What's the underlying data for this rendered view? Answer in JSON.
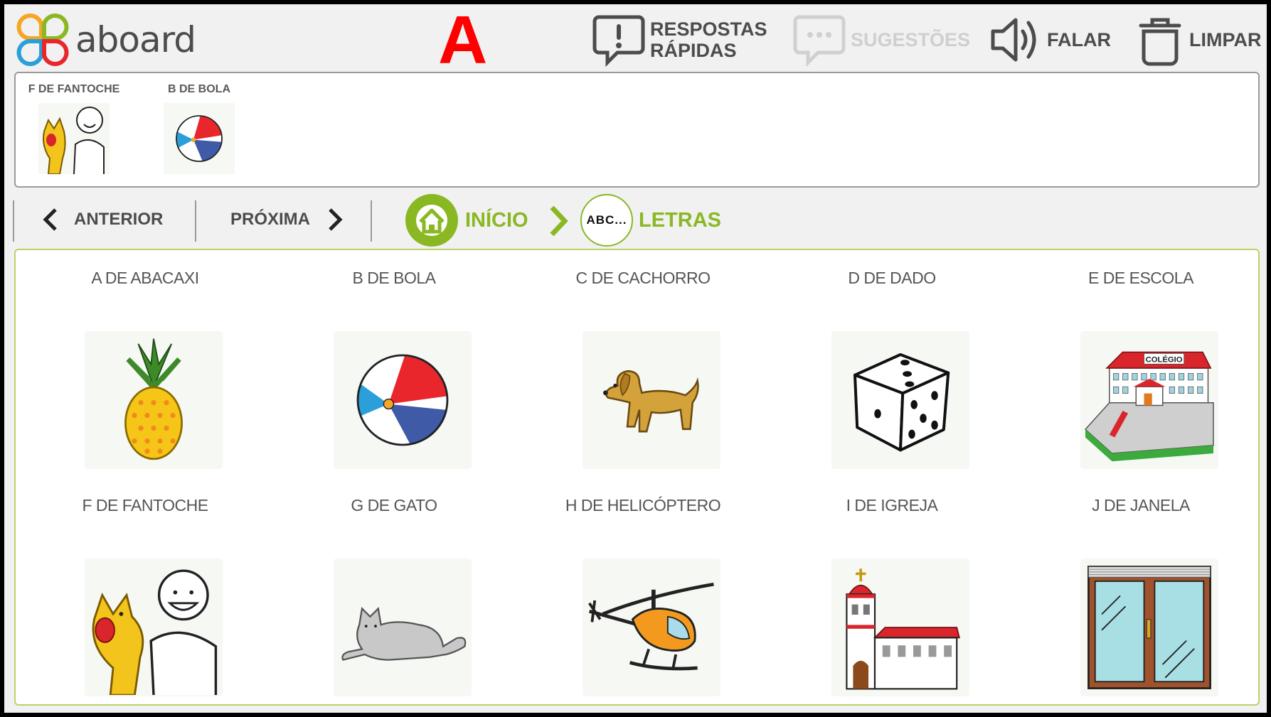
{
  "app": {
    "name": "aboard"
  },
  "header": {
    "current_letter": "A",
    "tools": [
      {
        "label_line1": "RESPOSTAS",
        "label_line2": "RÁPIDAS",
        "icon": "quick-reply-icon",
        "enabled": true
      },
      {
        "label_line1": "SUGESTÕES",
        "label_line2": "",
        "icon": "suggestions-icon",
        "enabled": false
      },
      {
        "label_line1": "FALAR",
        "label_line2": "",
        "icon": "speaker-icon",
        "enabled": true
      },
      {
        "label_line1": "LIMPAR",
        "label_line2": "",
        "icon": "trash-icon",
        "enabled": true
      }
    ]
  },
  "message": {
    "items": [
      {
        "label": "F DE FANTOCHE",
        "icon": "puppet-icon"
      },
      {
        "label": "B DE BOLA",
        "icon": "ball-icon"
      }
    ]
  },
  "nav": {
    "previous_label": "ANTERIOR",
    "next_label": "PRÓXIMA",
    "breadcrumb": [
      {
        "label": "INÍCIO",
        "icon": "home-icon"
      },
      {
        "label": "LETRAS",
        "icon_text": "ABC..."
      }
    ]
  },
  "grid": {
    "cards": [
      {
        "label": "A DE ABACAXI",
        "icon": "pineapple-icon"
      },
      {
        "label": "B DE BOLA",
        "icon": "ball-icon"
      },
      {
        "label": "C DE CACHORRO",
        "icon": "dog-icon"
      },
      {
        "label": "D DE DADO",
        "icon": "dice-icon"
      },
      {
        "label": "E DE ESCOLA",
        "icon": "school-icon",
        "sign_text": "COLÉGIO"
      },
      {
        "label": "F DE FANTOCHE",
        "icon": "puppet-icon"
      },
      {
        "label": "G DE GATO",
        "icon": "cat-icon"
      },
      {
        "label": "H DE HELICÓPTERO",
        "icon": "helicopter-icon"
      },
      {
        "label": "I DE IGREJA",
        "icon": "church-icon"
      },
      {
        "label": "J DE JANELA",
        "icon": "window-icon"
      }
    ]
  },
  "colors": {
    "accent_green": "#8ab823",
    "letter_red": "#ff0000",
    "text_gray": "#4c4c4c",
    "disabled_gray": "#cfcfcf"
  }
}
